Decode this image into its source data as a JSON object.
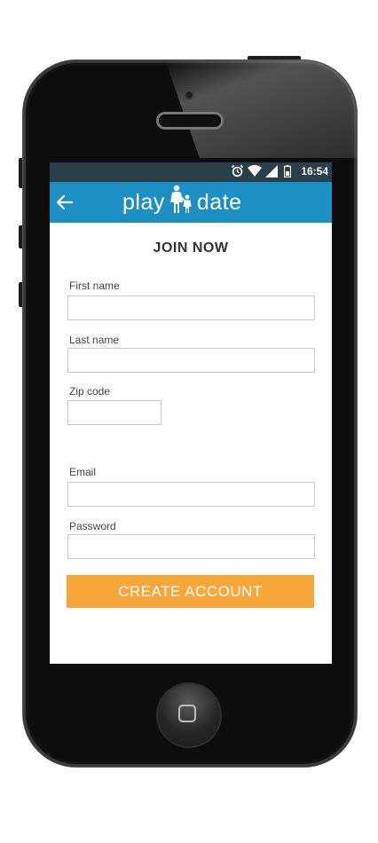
{
  "status_bar": {
    "time": "16:54",
    "icons": [
      "alarm-icon",
      "wifi-icon",
      "signal-icon",
      "battery-icon"
    ]
  },
  "app_bar": {
    "back_icon": "back-arrow-icon",
    "logo_left": "play",
    "logo_right": "date",
    "logo_icon": "parent-child-icon",
    "color": "#1c90c4"
  },
  "form": {
    "title": "JOIN NOW",
    "first_name": {
      "label": "First name",
      "value": ""
    },
    "last_name": {
      "label": "Last name",
      "value": ""
    },
    "zip_code": {
      "label": "Zip code",
      "value": ""
    },
    "email": {
      "label": "Email",
      "value": ""
    },
    "password": {
      "label": "Password",
      "value": ""
    },
    "submit_label": "CREATE ACCOUNT",
    "submit_color": "#f7a63a"
  }
}
